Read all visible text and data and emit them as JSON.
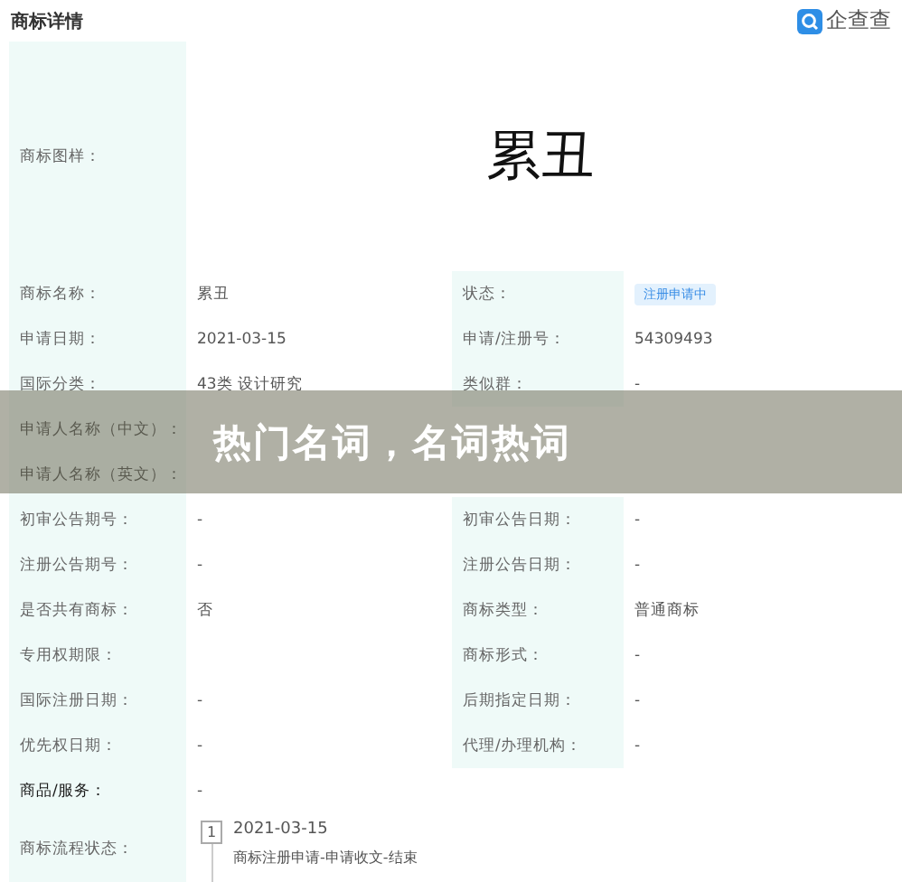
{
  "header": {
    "title": "商标详情",
    "logo_text": "企查查"
  },
  "image_row": {
    "label": "商标图样：",
    "mark_text": "累丑"
  },
  "rows": [
    {
      "label": "商标名称：",
      "value": "累丑",
      "right_label": "状态：",
      "right_badge": "注册申请中"
    },
    {
      "label": "申请日期：",
      "value": "2021-03-15",
      "right_label": "申请/注册号：",
      "right_value": "54309493"
    },
    {
      "label": "国际分类：",
      "value": "43类 设计研究",
      "right_label": "类似群：",
      "right_value": "-"
    },
    {
      "label": "申请人名称（中文）："
    },
    {
      "label": "申请人名称（英文）："
    },
    {
      "label": "初审公告期号：",
      "value": "-",
      "right_label": "初审公告日期：",
      "right_value": "-"
    },
    {
      "label": "注册公告期号：",
      "value": "-",
      "right_label": "注册公告日期：",
      "right_value": "-"
    },
    {
      "label": "是否共有商标：",
      "value": "否",
      "right_label": "商标类型：",
      "right_value": "普通商标"
    },
    {
      "label": "专用权期限：",
      "right_label": "商标形式：",
      "right_value": "-"
    },
    {
      "label": "国际注册日期：",
      "value": "-",
      "right_label": "后期指定日期：",
      "right_value": "-"
    },
    {
      "label": "优先权日期：",
      "value": "-",
      "right_label": "代理/办理机构：",
      "right_value": "-"
    },
    {
      "label": "商品/服务：",
      "value": "-"
    }
  ],
  "process": {
    "label": "商标流程状态：",
    "steps": [
      {
        "number": "1",
        "date": "2021-03-15",
        "text": "商标注册申请-申请收文-结束"
      }
    ]
  },
  "overlay": {
    "text": "热门名词，名词热词"
  }
}
